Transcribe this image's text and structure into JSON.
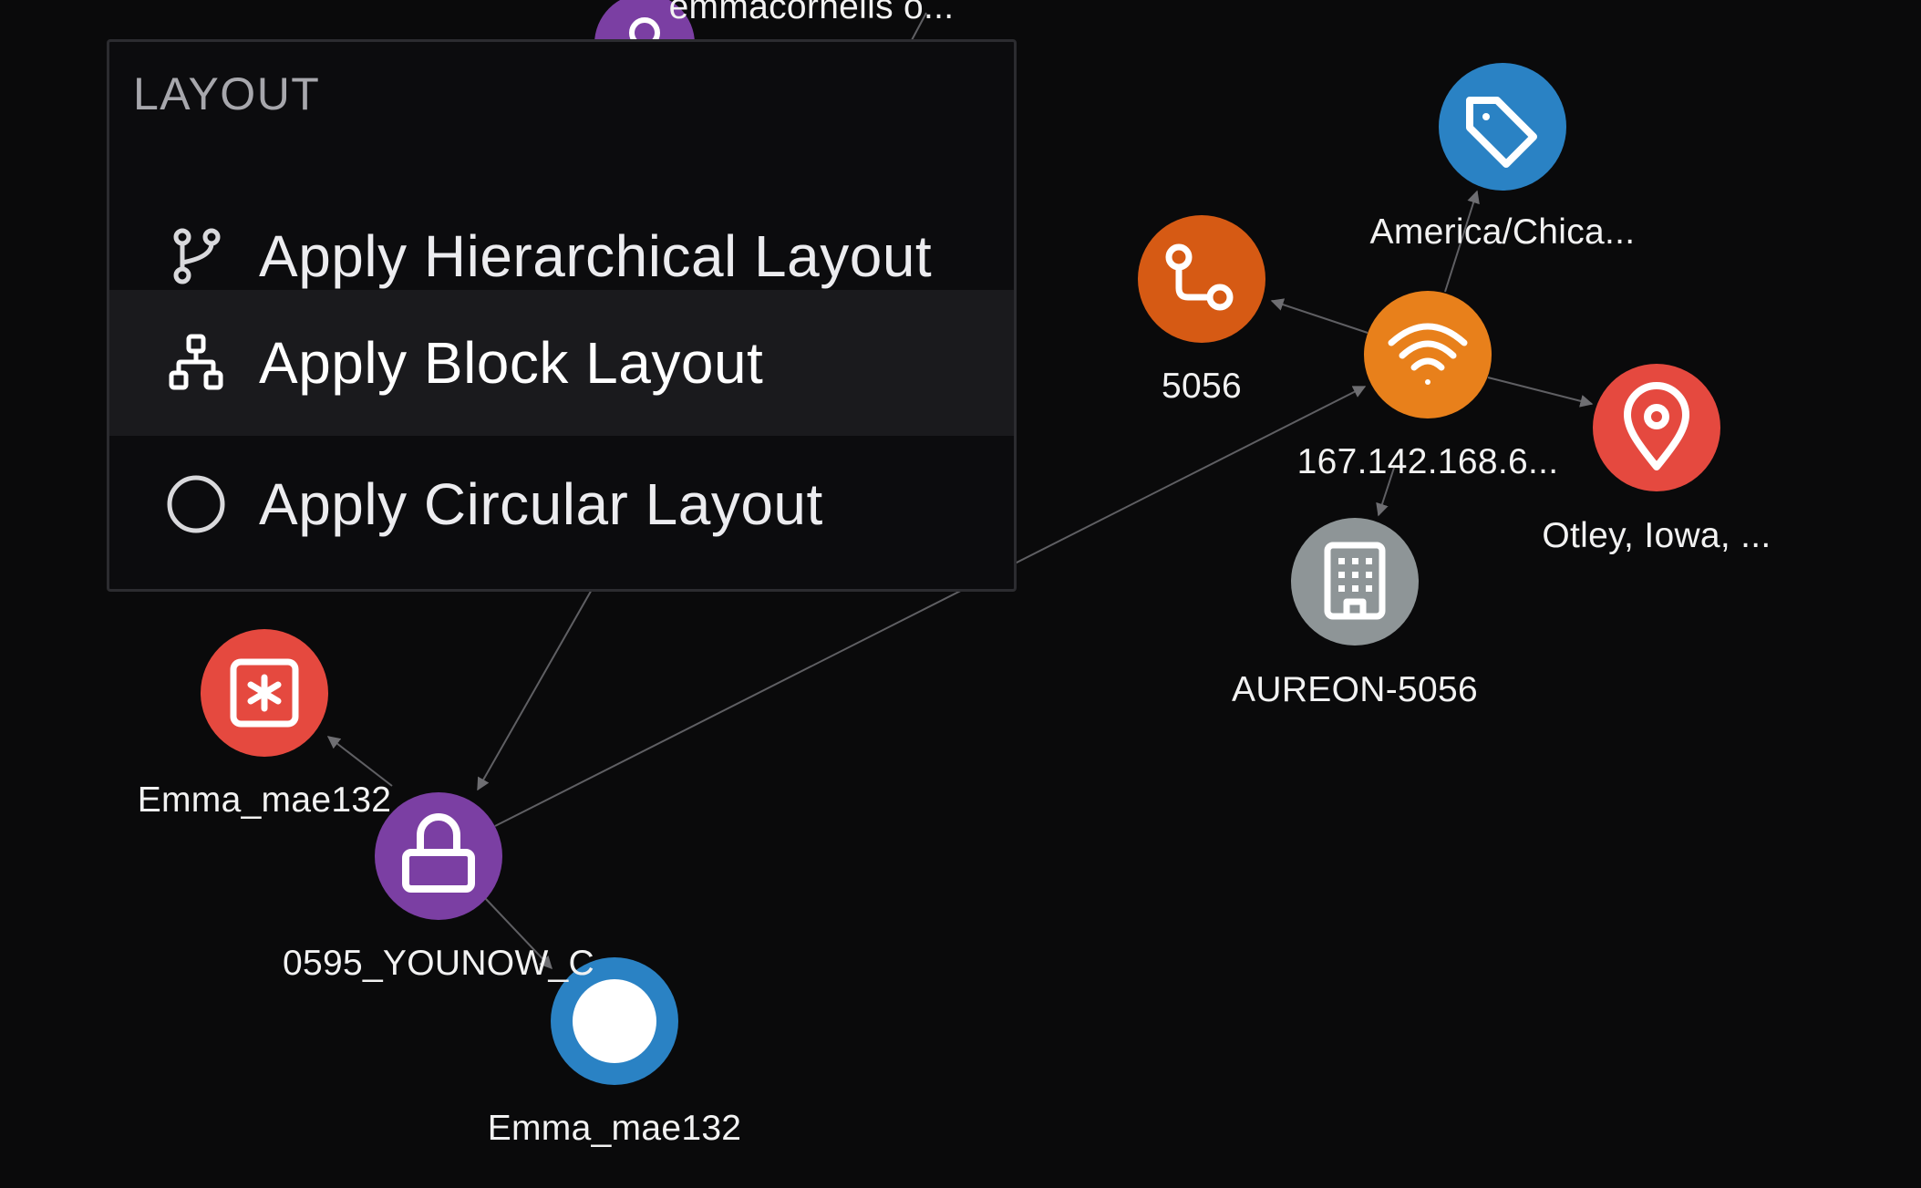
{
  "colors": {
    "background": "#0a0a0b",
    "edge": "#6e6e72",
    "purple": "#7b3fa3",
    "orange": "#e8801b",
    "dark_orange": "#d65a14",
    "blue": "#2a82c4",
    "red": "#e5493f",
    "gray": "#8e9597",
    "white": "#ffffff"
  },
  "menu": {
    "title": "LAYOUT",
    "items": [
      {
        "label": "Apply Hierarchical Layout",
        "icon": "git-branch-icon"
      },
      {
        "label": "Apply Block Layout",
        "icon": "sitemap-icon",
        "active": true
      },
      {
        "label": "Apply Circular Layout",
        "icon": "circle-icon"
      }
    ]
  },
  "nodes": [
    {
      "id": "emma_top",
      "label": "emmacornelis o...",
      "color": "purple",
      "icon": "user-icon"
    },
    {
      "id": "tz",
      "label": "America/Chica...",
      "color": "blue",
      "icon": "tag-icon"
    },
    {
      "id": "asn",
      "label": "5056",
      "color": "dark_orange",
      "icon": "route-icon"
    },
    {
      "id": "ip",
      "label": "167.142.168.6...",
      "color": "orange",
      "icon": "wifi-icon"
    },
    {
      "id": "loc",
      "label": "Otley, Iowa, ...",
      "color": "red",
      "icon": "map-pin-icon"
    },
    {
      "id": "org",
      "label": "AUREON-5056",
      "color": "gray",
      "icon": "building-icon"
    },
    {
      "id": "acct",
      "label": "Emma_mae132",
      "color": "red",
      "icon": "asterisk-icon"
    },
    {
      "id": "pwd",
      "label": "0595_YOUNOW_C",
      "color": "purple",
      "icon": "lock-icon"
    },
    {
      "id": "user2",
      "label": "Emma_mae132",
      "color": "blue",
      "icon": "circle-icon"
    }
  ]
}
